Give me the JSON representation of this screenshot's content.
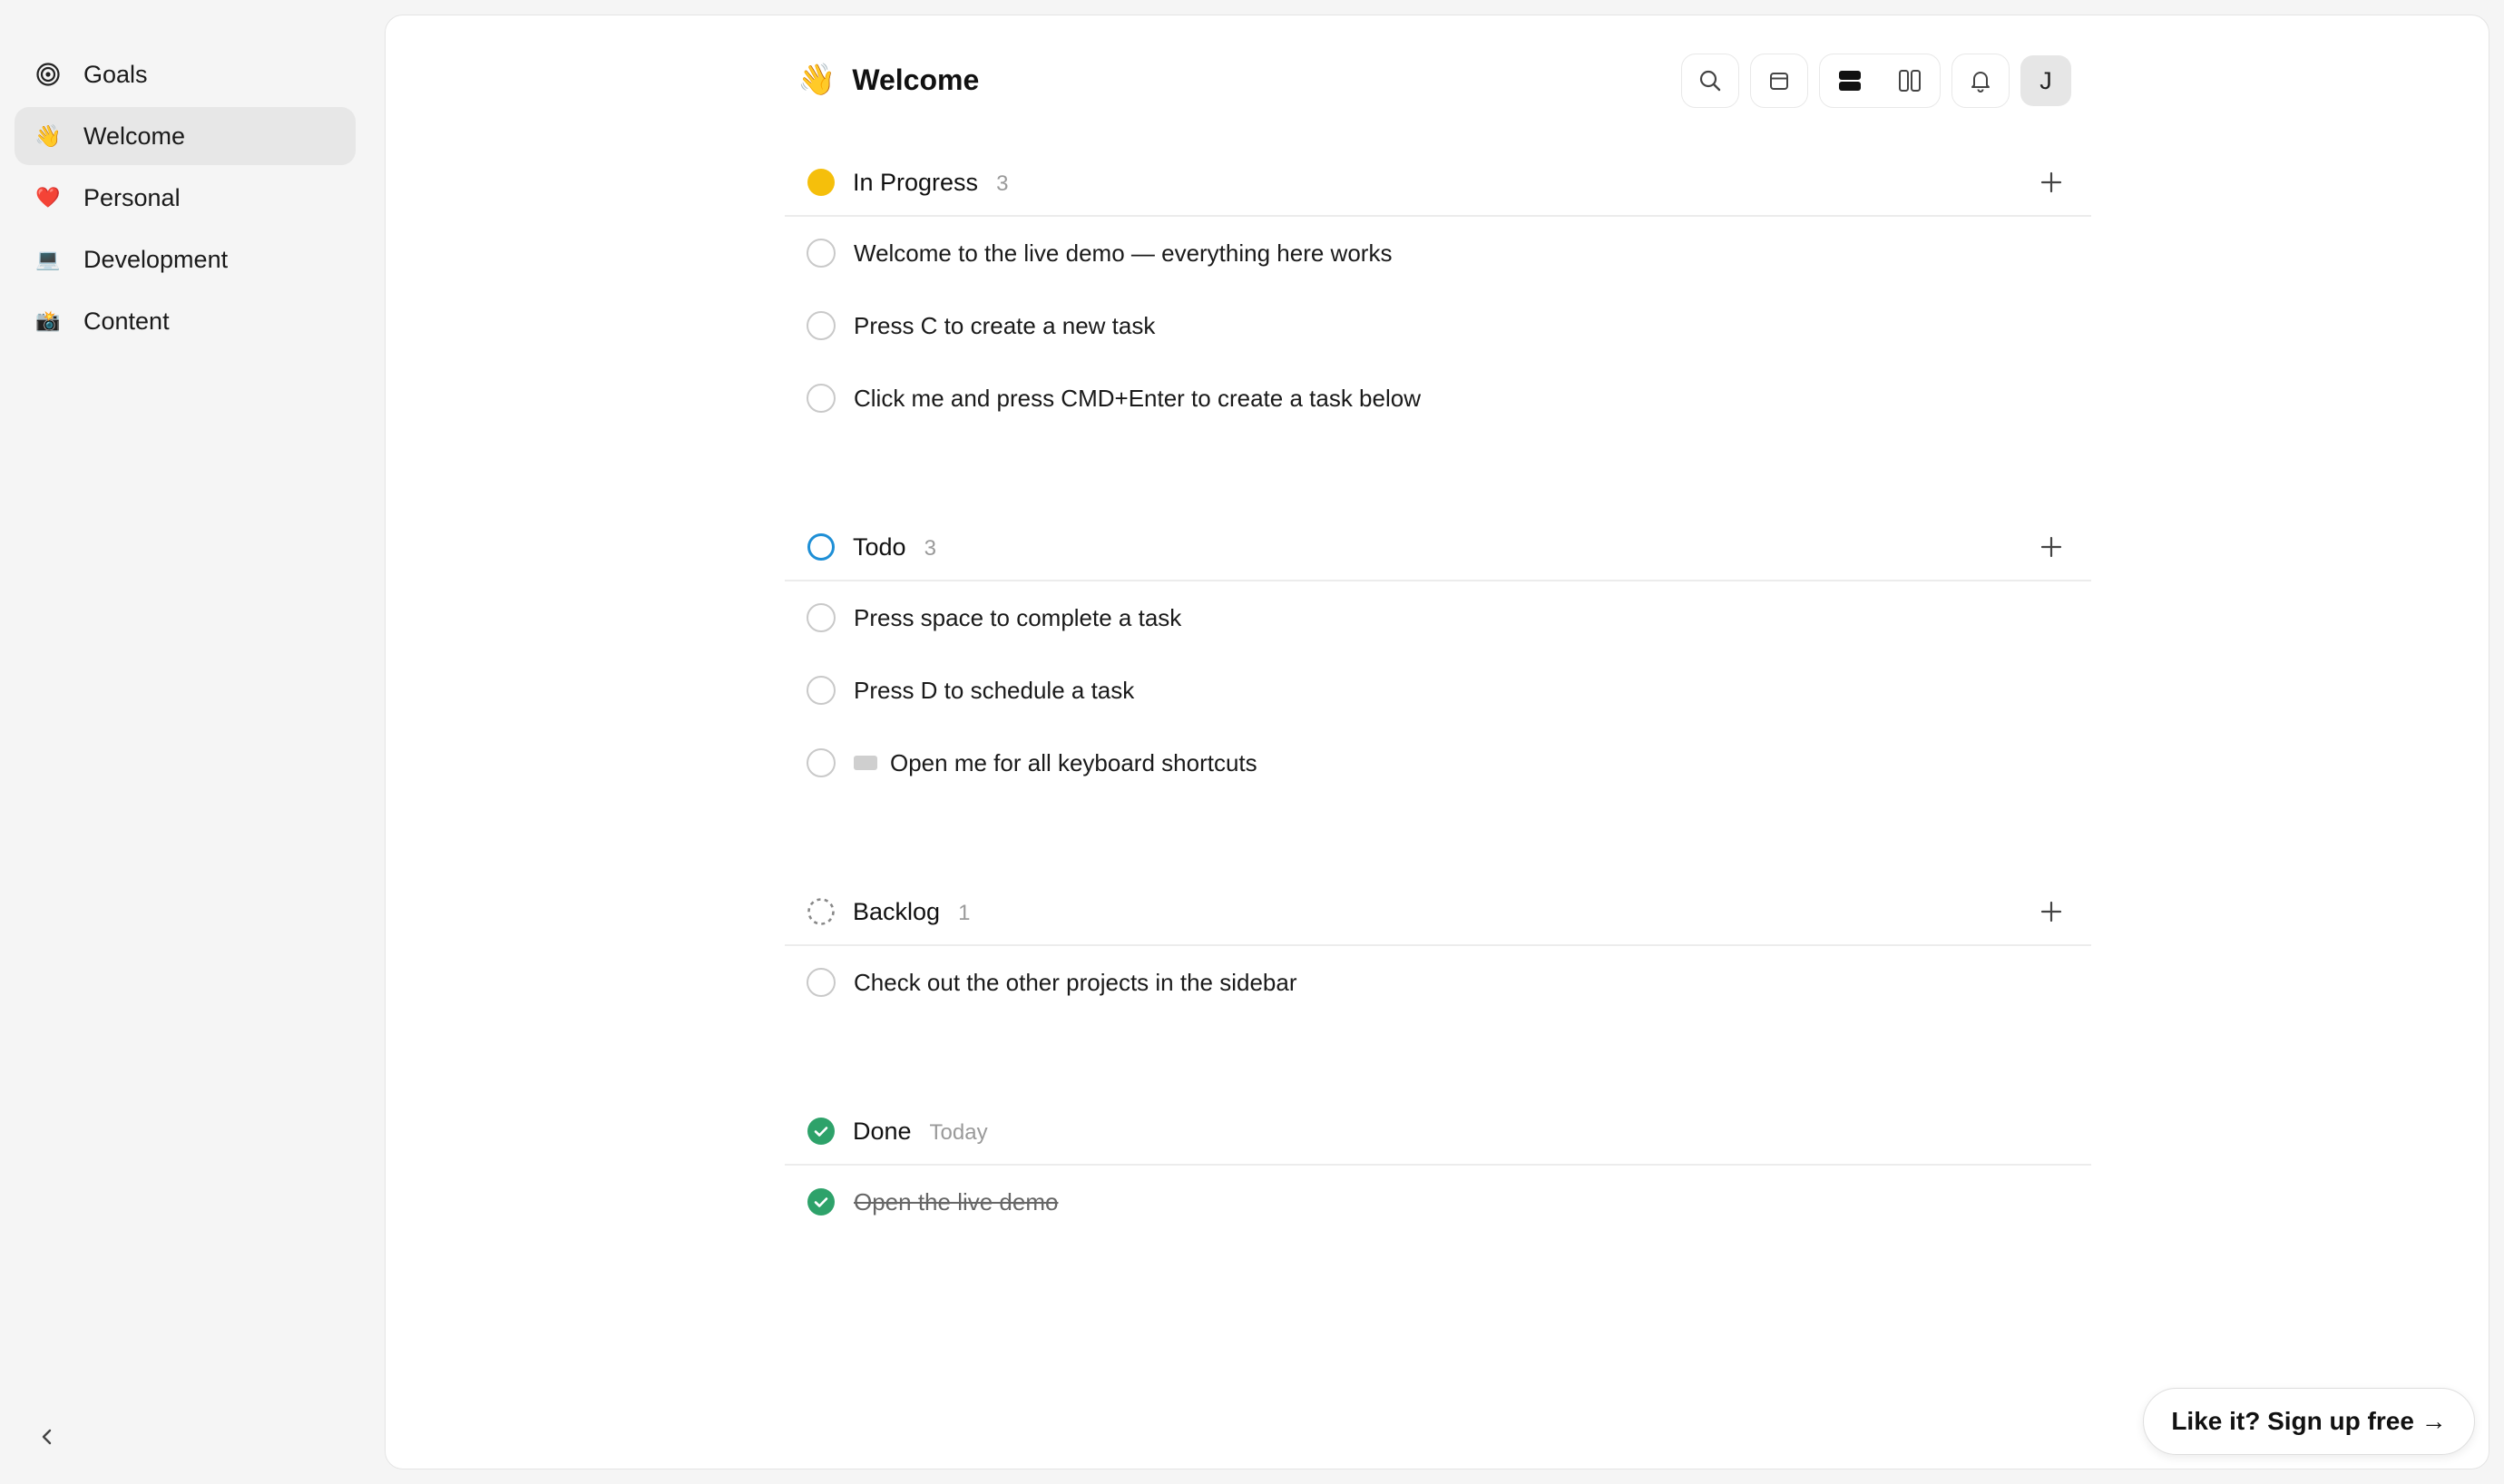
{
  "sidebar": {
    "items": [
      {
        "label": "Goals",
        "icon": "target-icon"
      },
      {
        "label": "Welcome",
        "icon": "👋",
        "active": true
      },
      {
        "label": "Personal",
        "icon": "❤️"
      },
      {
        "label": "Development",
        "icon": "💻"
      },
      {
        "label": "Content",
        "icon": "📸"
      }
    ],
    "collapse_icon": "chevron-left-icon"
  },
  "header": {
    "emoji": "👋",
    "title": "Welcome",
    "toolbar": [
      "search-icon",
      "calendar-icon",
      "list-view-icon",
      "board-view-icon",
      "bell-icon"
    ],
    "avatar_initial": "J"
  },
  "sections": [
    {
      "name": "In Progress",
      "count": "3",
      "status": "in-progress",
      "color": "#f5bf0b",
      "tasks": [
        {
          "title": "Welcome to the live demo — everything here works"
        },
        {
          "title": "Press C to create a new task"
        },
        {
          "title": "Click me and press CMD+Enter to create a task below"
        }
      ]
    },
    {
      "name": "Todo",
      "count": "3",
      "status": "todo",
      "color": "#1e8fd6",
      "tasks": [
        {
          "title": "Press space to complete a task"
        },
        {
          "title": "Press D to schedule a task"
        },
        {
          "title": "Open me for all keyboard shortcuts",
          "icon": "⌨️"
        }
      ]
    },
    {
      "name": "Backlog",
      "count": "1",
      "status": "backlog",
      "color": "#9a9a9a",
      "tasks": [
        {
          "title": "Check out the other projects in the sidebar"
        }
      ]
    },
    {
      "name": "Done",
      "count": "Today",
      "status": "done",
      "color": "#2ea26a",
      "tasks": [
        {
          "title": "Open the live demo",
          "done": true
        }
      ]
    }
  ],
  "cta": {
    "label": "Like it? Sign up free →"
  }
}
